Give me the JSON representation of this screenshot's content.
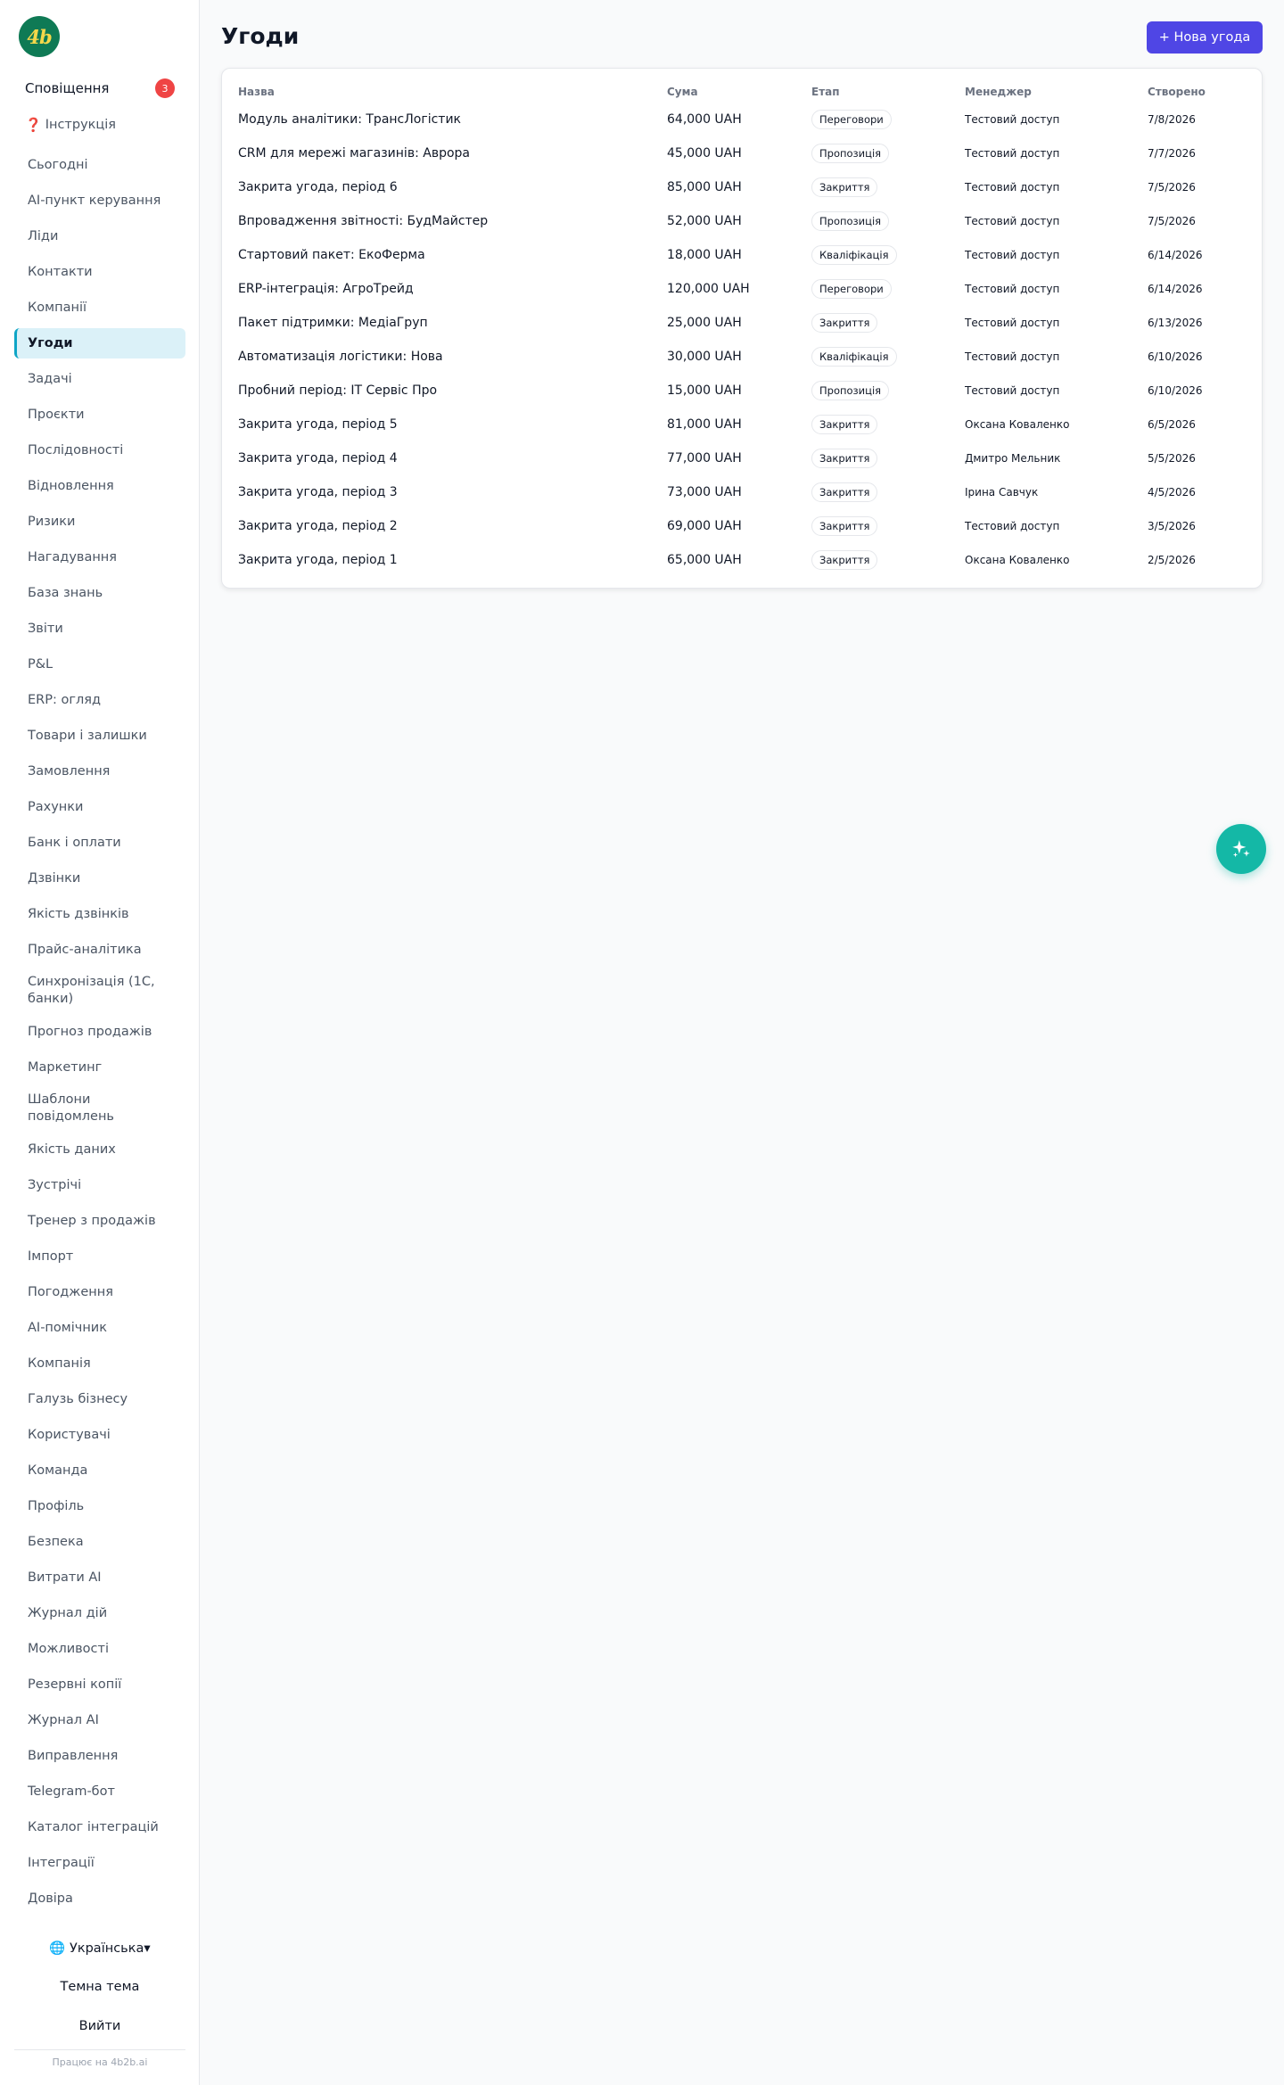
{
  "logo": {
    "text": "4b"
  },
  "sidebar": {
    "notifications_label": "Сповіщення",
    "notifications_count": "3",
    "guide_icon": "❓",
    "guide_label": "Інструкція",
    "items": [
      {
        "label": "Сьогодні"
      },
      {
        "label": "AI-пункт керування"
      },
      {
        "label": "Ліди"
      },
      {
        "label": "Контакти"
      },
      {
        "label": "Компанії"
      },
      {
        "label": "Угоди",
        "active": true
      },
      {
        "label": "Задачі"
      },
      {
        "label": "Проєкти"
      },
      {
        "label": "Послідовності"
      },
      {
        "label": "Відновлення"
      },
      {
        "label": "Ризики"
      },
      {
        "label": "Нагадування"
      },
      {
        "label": "База знань"
      },
      {
        "label": "Звіти"
      },
      {
        "label": "P&L"
      },
      {
        "label": "ERP: огляд"
      },
      {
        "label": "Товари і залишки"
      },
      {
        "label": "Замовлення"
      },
      {
        "label": "Рахунки"
      },
      {
        "label": "Банк і оплати"
      },
      {
        "label": "Дзвінки"
      },
      {
        "label": "Якість дзвінків"
      },
      {
        "label": "Прайс-аналітика"
      },
      {
        "label": "Синхронізація (1С, банки)"
      },
      {
        "label": "Прогноз продажів"
      },
      {
        "label": "Маркетинг"
      },
      {
        "label": "Шаблони повідомлень"
      },
      {
        "label": "Якість даних"
      },
      {
        "label": "Зустрічі"
      },
      {
        "label": "Тренер з продажів"
      },
      {
        "label": "Імпорт"
      },
      {
        "label": "Погодження"
      },
      {
        "label": "AI-помічник"
      },
      {
        "label": "Компанія"
      },
      {
        "label": "Галузь бізнесу"
      },
      {
        "label": "Користувачі"
      },
      {
        "label": "Команда"
      },
      {
        "label": "Профіль"
      },
      {
        "label": "Безпека"
      },
      {
        "label": "Витрати AI"
      },
      {
        "label": "Журнал дій"
      },
      {
        "label": "Можливості"
      },
      {
        "label": "Резервні копії"
      },
      {
        "label": "Журнал AI"
      },
      {
        "label": "Виправлення"
      },
      {
        "label": "Telegram-бот"
      },
      {
        "label": "Каталог інтеграцій"
      },
      {
        "label": "Інтеграції"
      },
      {
        "label": "Довіра"
      }
    ],
    "language": "🌐 Українська▾",
    "theme_label": "Темна тема",
    "logout_label": "Вийти",
    "powered_by": "Працює на 4b2b.ai"
  },
  "page": {
    "title": "Угоди",
    "new_button": "+ Нова угода"
  },
  "table": {
    "headers": [
      "Назва",
      "Сума",
      "Етап",
      "Менеджер",
      "Створено"
    ],
    "rows": [
      {
        "name": "Модуль аналітики: ТрансЛогістик",
        "amount": "64,000 UAH",
        "stage": "Переговори",
        "manager": "Тестовий доступ",
        "created": "7/8/2026"
      },
      {
        "name": "CRM для мережі магазинів: Аврора",
        "amount": "45,000 UAH",
        "stage": "Пропозиція",
        "manager": "Тестовий доступ",
        "created": "7/7/2026"
      },
      {
        "name": "Закрита угода, період 6",
        "amount": "85,000 UAH",
        "stage": "Закриття",
        "manager": "Тестовий доступ",
        "created": "7/5/2026"
      },
      {
        "name": "Впровадження звітності: БудМайстер",
        "amount": "52,000 UAH",
        "stage": "Пропозиція",
        "manager": "Тестовий доступ",
        "created": "7/5/2026"
      },
      {
        "name": "Стартовий пакет: ЕкоФерма",
        "amount": "18,000 UAH",
        "stage": "Кваліфікація",
        "manager": "Тестовий доступ",
        "created": "6/14/2026"
      },
      {
        "name": "ERP-інтеграція: АгроТрейд",
        "amount": "120,000 UAH",
        "stage": "Переговори",
        "manager": "Тестовий доступ",
        "created": "6/14/2026"
      },
      {
        "name": "Пакет підтримки: МедіаГруп",
        "amount": "25,000 UAH",
        "stage": "Закриття",
        "manager": "Тестовий доступ",
        "created": "6/13/2026"
      },
      {
        "name": "Автоматизація логістики: Нова",
        "amount": "30,000 UAH",
        "stage": "Кваліфікація",
        "manager": "Тестовий доступ",
        "created": "6/10/2026"
      },
      {
        "name": "Пробний період: IT Сервіс Про",
        "amount": "15,000 UAH",
        "stage": "Пропозиція",
        "manager": "Тестовий доступ",
        "created": "6/10/2026"
      },
      {
        "name": "Закрита угода, період 5",
        "amount": "81,000 UAH",
        "stage": "Закриття",
        "manager": "Оксана Коваленко",
        "created": "6/5/2026"
      },
      {
        "name": "Закрита угода, період 4",
        "amount": "77,000 UAH",
        "stage": "Закриття",
        "manager": "Дмитро Мельник",
        "created": "5/5/2026"
      },
      {
        "name": "Закрита угода, період 3",
        "amount": "73,000 UAH",
        "stage": "Закриття",
        "manager": "Ірина Савчук",
        "created": "4/5/2026"
      },
      {
        "name": "Закрита угода, період 2",
        "amount": "69,000 UAH",
        "stage": "Закриття",
        "manager": "Тестовий доступ",
        "created": "3/5/2026"
      },
      {
        "name": "Закрита угода, період 1",
        "amount": "65,000 UAH",
        "stage": "Закриття",
        "manager": "Оксана Коваленко",
        "created": "2/5/2026"
      }
    ]
  },
  "fab": {
    "icon": "sparkles-icon"
  },
  "colors": {
    "accent": "#4f46e5",
    "active_nav": "#dbf1f8",
    "fab": "#14b8a6",
    "badge": "#ef4444",
    "logo_bg": "#0f7a55"
  }
}
